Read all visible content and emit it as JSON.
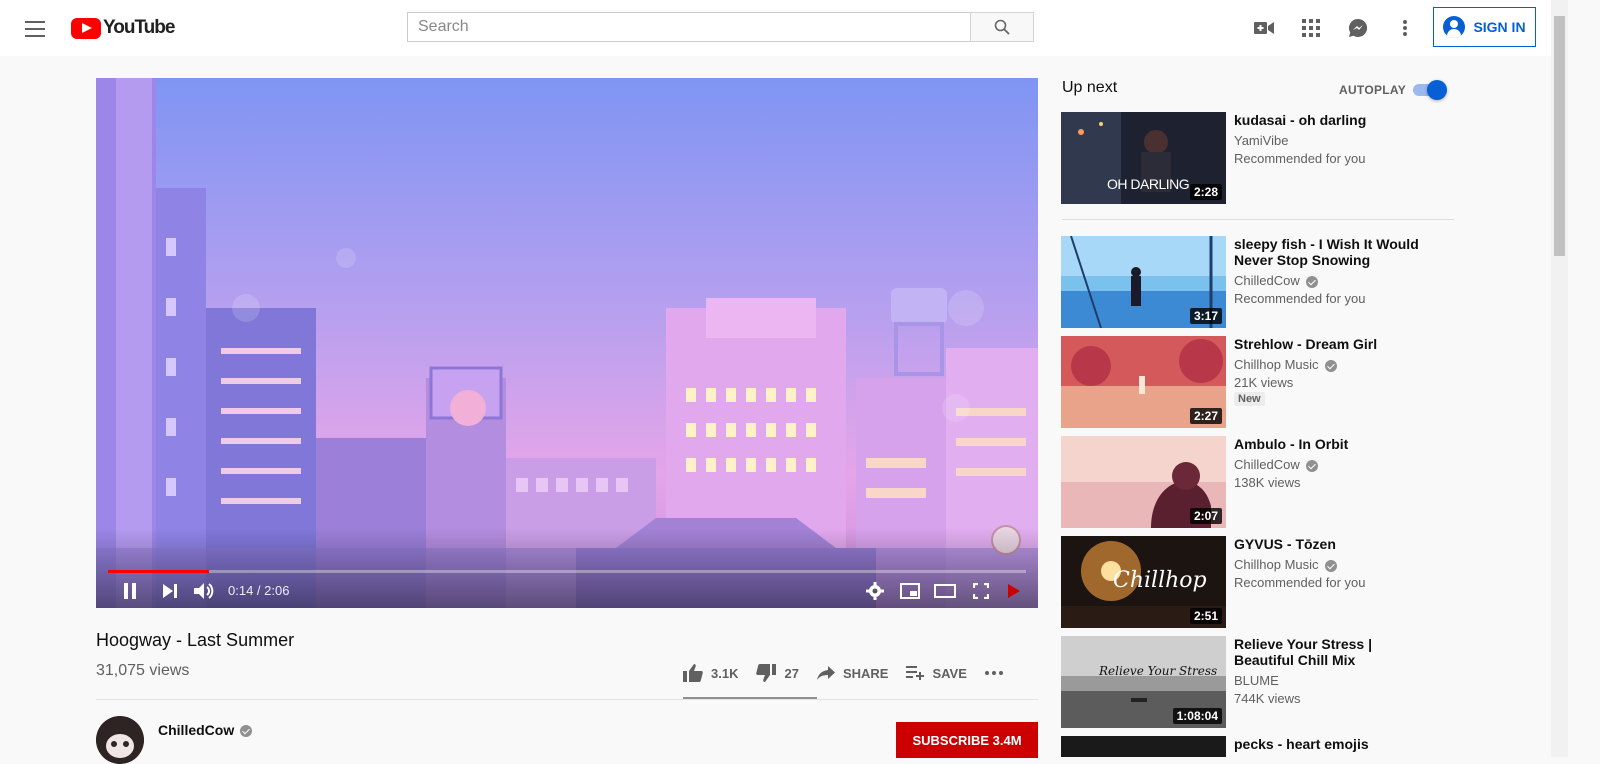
{
  "header": {
    "logo_text": "YouTube",
    "search_placeholder": "Search",
    "sign_in_label": "SIGN IN"
  },
  "player": {
    "current_time": "0:14",
    "duration": "2:06",
    "time_display": "0:14 / 2:06",
    "progress_fraction": 0.11,
    "buffer_fraction": 0.11
  },
  "video": {
    "title": "Hoogway - Last Summer",
    "views": "31,075 views",
    "likes": "3.1K",
    "dislikes": "27",
    "share_label": "SHARE",
    "save_label": "SAVE"
  },
  "channel": {
    "name": "ChilledCow",
    "subscribe_label": "SUBSCRIBE 3.4M"
  },
  "sidebar": {
    "up_next_label": "Up next",
    "autoplay_label": "AUTOPLAY",
    "autoplay_on": true,
    "items": [
      {
        "title": "kudasai - oh darling",
        "channel": "YamiVibe",
        "meta": "Recommended for you",
        "duration": "2:28",
        "thumb_text": "OH DARLING",
        "verified": false
      },
      {
        "title": "sleepy fish - I Wish It Would Never Stop Snowing",
        "channel": "ChilledCow",
        "meta": "Recommended for you",
        "duration": "3:17",
        "verified": true
      },
      {
        "title": "Strehlow - Dream Girl",
        "channel": "Chillhop Music",
        "meta": "21K views",
        "badge": "New",
        "duration": "2:27",
        "verified": true
      },
      {
        "title": "Ambulo - In Orbit",
        "channel": "ChilledCow",
        "meta": "138K views",
        "duration": "2:07",
        "verified": true
      },
      {
        "title": "GYVUS - Tōzen",
        "channel": "Chillhop Music",
        "meta": "Recommended for you",
        "duration": "2:51",
        "thumb_text": "Chillhop",
        "verified": true
      },
      {
        "title": "Relieve Your Stress | Beautiful Chill Mix",
        "channel": "BLUME",
        "meta": "744K views",
        "duration": "1:08:04",
        "thumb_text": "Relieve Your Stress",
        "verified": false
      },
      {
        "title": "pecks - heart emojis",
        "channel": "",
        "meta": "",
        "duration": "",
        "verified": false
      }
    ]
  },
  "colors": {
    "brand_red": "#ff0000",
    "link_blue": "#065fd4",
    "subscribe_red": "#cc0000",
    "progress_red": "#ff0000"
  }
}
